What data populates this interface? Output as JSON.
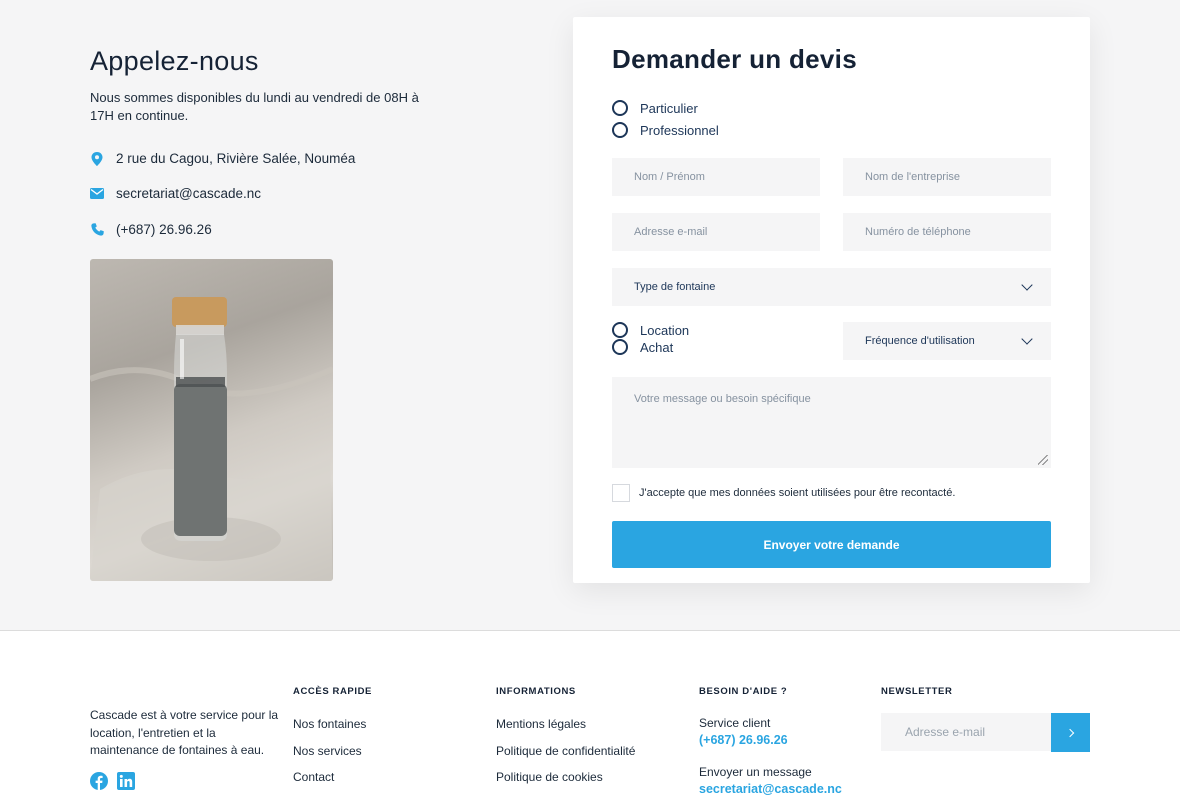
{
  "contact": {
    "title": "Appelez-nous",
    "description": "Nous sommes disponibles du lundi au vendredi de 08H à 17H en continue.",
    "address": "2 rue du Cagou, Rivière Salée, Nouméa",
    "email": "secretariat@cascade.nc",
    "phone": "(+687) 26.96.26",
    "icons": {
      "address": "map-pin-icon",
      "email": "envelope-icon",
      "phone": "phone-icon"
    },
    "photo": "bottle-in-sand-photo"
  },
  "form": {
    "title": "Demander un devis",
    "customer_types": [
      "Particulier",
      "Professionnel"
    ],
    "name_placeholder": "Nom / Prénom",
    "company_placeholder": "Nom de l'entreprise",
    "email_placeholder": "Adresse e-mail",
    "phone_placeholder": "Numéro de téléphone",
    "fountain_type": "Type de fontaine",
    "purchase_modes": [
      "Location",
      "Achat"
    ],
    "frequency": "Fréquence d'utilisation",
    "message_placeholder": "Votre message ou besoin spécifique",
    "consent": "J'accepte que mes données soient utilisées pour être recontacté.",
    "submit": "Envoyer votre demande"
  },
  "footer": {
    "description": "Cascade est à votre service pour la location, l'entretien et la maintenance de fontaines à eau.",
    "social": [
      "facebook-icon",
      "linkedin-icon"
    ],
    "quick_access": {
      "heading": "ACCÈS RAPIDE",
      "links": [
        "Nos fontaines",
        "Nos services",
        "Contact"
      ]
    },
    "informations": {
      "heading": "INFORMATIONS",
      "links": [
        "Mentions légales",
        "Politique de confidentialité",
        "Politique de cookies"
      ]
    },
    "help": {
      "heading": "BESOIN D'AIDE ?",
      "service_label": "Service client",
      "service_phone": "(+687) 26.96.26",
      "message_label": "Envoyer un message",
      "message_email": "secretariat@cascade.nc"
    },
    "newsletter": {
      "heading": "NEWSLETTER",
      "placeholder": "Adresse e-mail"
    }
  },
  "colors": {
    "accent": "#2aa5e1",
    "navy": "#1d3658",
    "background": "#f5f5f6"
  }
}
